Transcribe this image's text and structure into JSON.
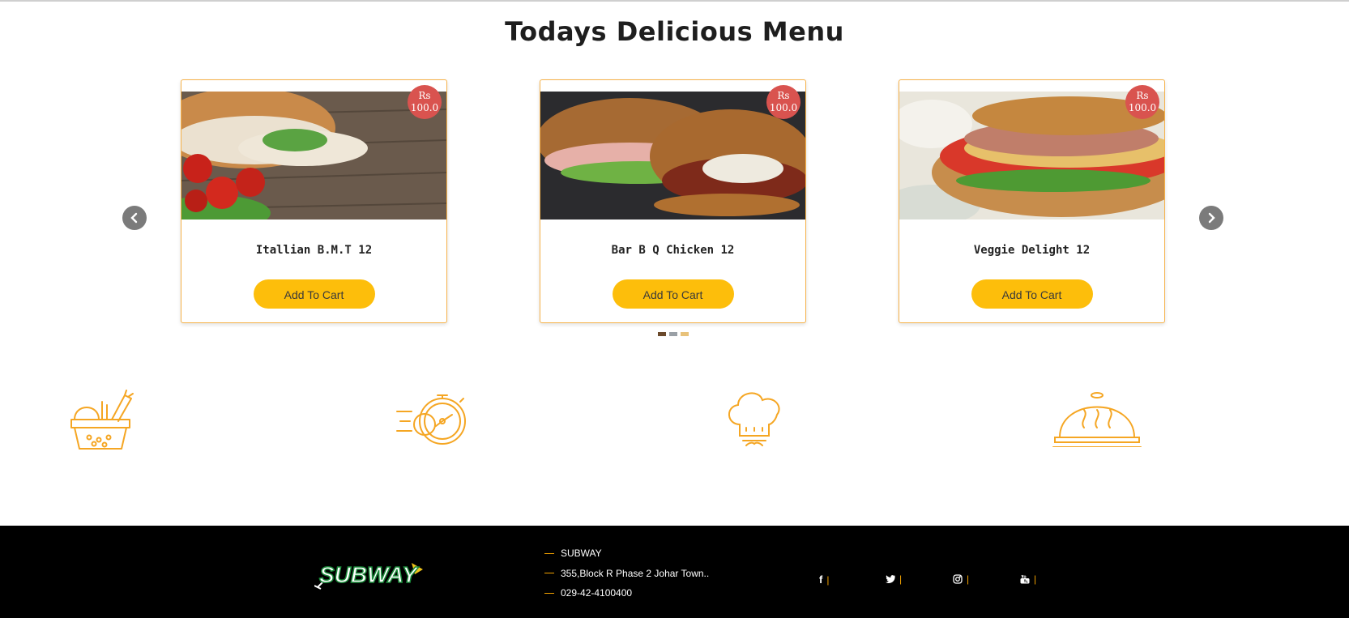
{
  "page": {
    "title": "Todays Delicious Menu"
  },
  "carousel": {
    "prev_icon": "chevron-left-icon",
    "next_icon": "chevron-right-icon",
    "cards": [
      {
        "currency": "Rs",
        "price": "100.0",
        "name": "Itallian B.M.T 12",
        "button": "Add To Cart"
      },
      {
        "currency": "Rs",
        "price": "100.0",
        "name": "Bar B Q Chicken 12",
        "button": "Add To Cart"
      },
      {
        "currency": "Rs",
        "price": "100.0",
        "name": "Veggie Delight 12",
        "button": "Add To Cart"
      }
    ],
    "indicator_count": 3
  },
  "features": [
    {
      "icon": "grocery-basket-icon"
    },
    {
      "icon": "fast-stopwatch-icon"
    },
    {
      "icon": "chef-hat-icon"
    },
    {
      "icon": "serving-cloche-icon"
    }
  ],
  "footer": {
    "logo_text": "SUBWAY",
    "info": [
      "SUBWAY",
      "355,Block R Phase 2 Johar Town..",
      "029-42-4100400"
    ],
    "social": [
      {
        "icon": "facebook-icon",
        "glyph": "f",
        "divider": "|"
      },
      {
        "icon": "twitter-icon",
        "glyph": "🐦",
        "divider": "|"
      },
      {
        "icon": "instagram-icon",
        "glyph": "◎",
        "divider": "|"
      },
      {
        "icon": "youtube-icon",
        "glyph": "▶",
        "divider": "|"
      }
    ]
  },
  "colors": {
    "accent": "#fdbe0b",
    "icon_orange": "#f5a623",
    "price_badge": "#d9534f",
    "card_border": "#f6b24a",
    "footer_bg": "#000000",
    "footer_dash": "#f0a000"
  }
}
